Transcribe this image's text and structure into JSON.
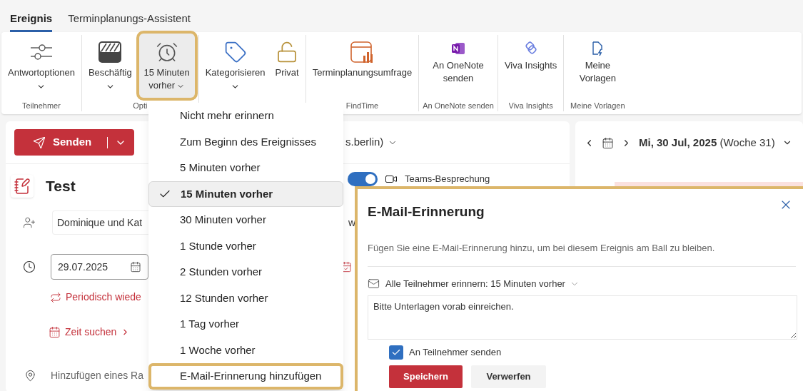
{
  "tabs": [
    {
      "label": "Ereignis",
      "selected": true
    },
    {
      "label": "Terminplanungs-Assistent",
      "selected": false
    }
  ],
  "ribbon": {
    "groups": [
      {
        "label": "Teilnehmer",
        "buttons": [
          {
            "label": "Antwortoptionen",
            "dropdown": true,
            "active": false
          }
        ]
      },
      {
        "label": "Opti",
        "buttons": [
          {
            "label": "Beschäftig",
            "dropdown": true,
            "active": false
          },
          {
            "label": "15 Minuten vorher",
            "dropdown": true,
            "active": true
          }
        ]
      },
      {
        "buttons": [
          {
            "label": "Kategorisieren",
            "dropdown": true,
            "active": false
          },
          {
            "label": "Privat",
            "dropdown": false,
            "active": false
          }
        ]
      },
      {
        "label": "FindTime",
        "buttons": [
          {
            "label": "Terminplanungsumfrage",
            "dropdown": false,
            "active": false
          }
        ]
      },
      {
        "label": "An OneNote senden",
        "buttons": [
          {
            "label": "An OneNote senden",
            "dropdown": false,
            "active": false
          }
        ]
      },
      {
        "label": "Viva Insights",
        "buttons": [
          {
            "label": "Viva Insights",
            "dropdown": false,
            "active": false
          }
        ]
      },
      {
        "label": "Meine Vorlagen",
        "buttons": [
          {
            "label": "Meine Vorlagen",
            "dropdown": false,
            "active": false
          }
        ]
      }
    ]
  },
  "compose": {
    "send_button": "Senden",
    "account": "s.berlin)",
    "title": "Test",
    "attendees": {
      "value": "Dominique und Kat"
    },
    "attendee_overflow": "w",
    "teams": {
      "label": "Teams-Besprechung",
      "on": true
    },
    "date": {
      "value": "29.07.2025"
    },
    "recurrence_link": "Periodisch wiede",
    "find_time_link": "Zeit suchen",
    "location": {
      "placeholder": "Hinzufügen eines Ra"
    }
  },
  "calendar": {
    "date_heading": "**Mi, 30 Jul, 2025** (Woche 31)"
  },
  "reminder_menu": {
    "items": [
      {
        "label": "Nicht mehr erinnern",
        "selected": false,
        "highlighted": false
      },
      {
        "label": "Zum Beginn des Ereignisses",
        "selected": false,
        "highlighted": false
      },
      {
        "label": "5 Minuten vorher",
        "selected": false,
        "highlighted": false
      },
      {
        "label": "15 Minuten vorher",
        "selected": true,
        "highlighted": false
      },
      {
        "label": "30 Minuten vorher",
        "selected": false,
        "highlighted": false
      },
      {
        "label": "1 Stunde vorher",
        "selected": false,
        "highlighted": false
      },
      {
        "label": "2 Stunden vorher",
        "selected": false,
        "highlighted": false
      },
      {
        "label": "12 Stunden vorher",
        "selected": false,
        "highlighted": false
      },
      {
        "label": "1 Tag vorher",
        "selected": false,
        "highlighted": false
      },
      {
        "label": "1 Woche vorher",
        "selected": false,
        "highlighted": false
      },
      {
        "label": "E-Mail-Erinnerung hinzufügen",
        "selected": false,
        "highlighted": true
      }
    ]
  },
  "email_dialog": {
    "title": "E-Mail-Erinnerung",
    "description": "Fügen Sie eine E-Mail-Erinnerung hinzu, um bei diesem Ereignis am Ball zu bleiben.",
    "reminder": "Alle Teilnehmer erinnern: 15 Minuten vorher",
    "message": {
      "value": "Bitte Unterlagen vorab einreichen."
    },
    "checkbox": {
      "label": "An Teilnehmer senden",
      "checked": true
    },
    "buttons": [
      {
        "label": "Speichern",
        "kind": "primary"
      },
      {
        "label": "Verwerfen",
        "kind": "secondary"
      }
    ]
  }
}
